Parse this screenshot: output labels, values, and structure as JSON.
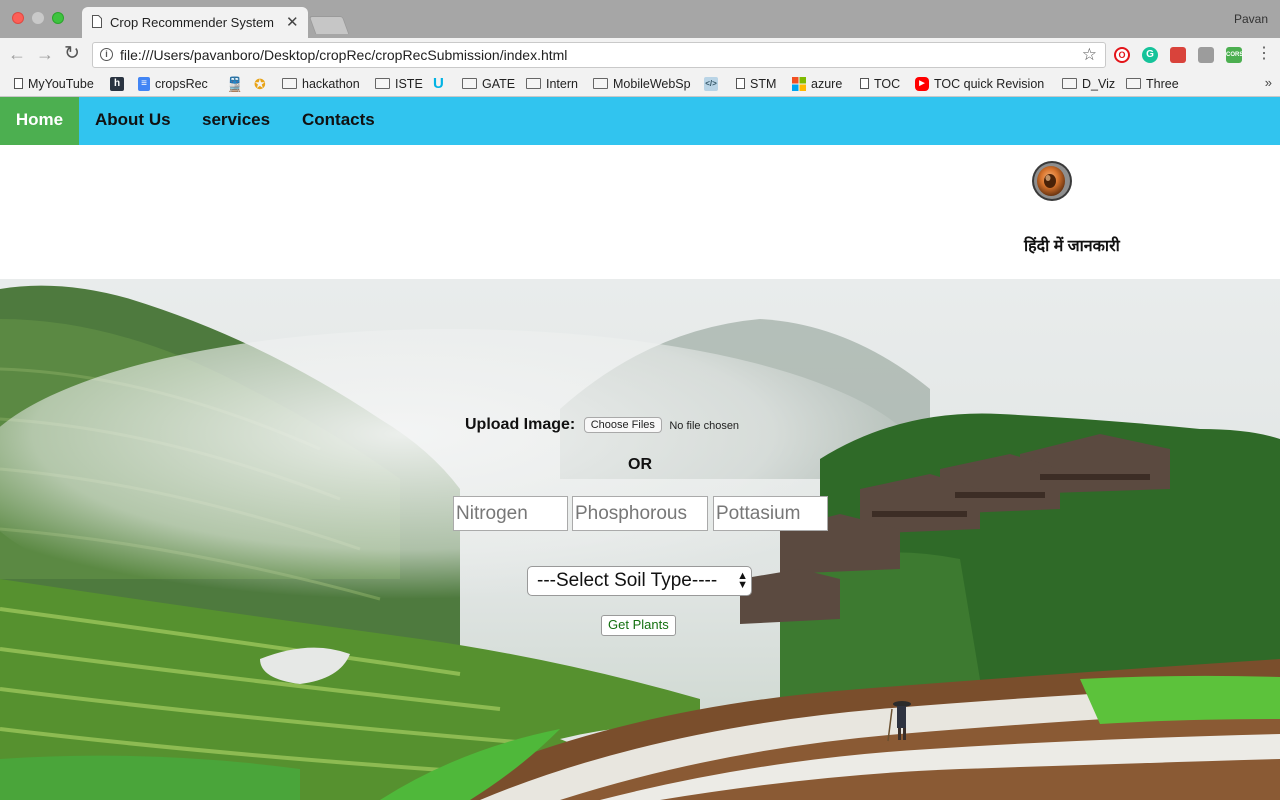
{
  "browser": {
    "tab_title": "Crop Recommender System",
    "tab_close": "✕",
    "profile_name": "Pavan",
    "url": "file:///Users/pavanboro/Desktop/cropRec/cropRecSubmission/index.html",
    "back": "←",
    "forward": "→",
    "reload": "↻",
    "star": "☆",
    "menu": "⋮",
    "ext_opera": "O",
    "ext_grammarly": "G",
    "ext_cors": "CORS",
    "bookmarks_more": "»",
    "bookmarks": [
      {
        "label": "MyYouTube",
        "icon": "page-icon"
      },
      {
        "label": "h",
        "icon": "hashnode-icon"
      },
      {
        "label": "cropsRec",
        "icon": "docs-icon"
      },
      {
        "label": "",
        "icon": "train-icon"
      },
      {
        "label": "",
        "icon": "star-logo-icon"
      },
      {
        "label": "hackathon",
        "icon": "folder-icon"
      },
      {
        "label": "ISTE",
        "icon": "folder-icon"
      },
      {
        "label": "",
        "icon": "udacity-icon"
      },
      {
        "label": "GATE",
        "icon": "folder-icon"
      },
      {
        "label": "Intern",
        "icon": "folder-icon"
      },
      {
        "label": "MobileWebSp",
        "icon": "folder-icon"
      },
      {
        "label": "",
        "icon": "code-icon"
      },
      {
        "label": "STM",
        "icon": "page-icon"
      },
      {
        "label": "azure",
        "icon": "microsoft-icon"
      },
      {
        "label": "TOC",
        "icon": "page-icon"
      },
      {
        "label": "TOC quick Revision",
        "icon": "youtube-icon"
      },
      {
        "label": "D_Viz",
        "icon": "folder-icon"
      },
      {
        "label": "Three",
        "icon": "folder-icon"
      }
    ]
  },
  "nav": {
    "home": "Home",
    "about": "About Us",
    "services": "services",
    "contacts": "Contacts"
  },
  "audio": {
    "hindi_label": "हिंदी में जानकारी",
    "icon": "speaker-icon"
  },
  "form": {
    "upload_label": "Upload Image:",
    "choose_files": "Choose Files",
    "no_file": "No file chosen",
    "or": "OR",
    "nitrogen_placeholder": "Nitrogen",
    "phosphorous_placeholder": "Phosphorous",
    "potassium_placeholder": "Pottasium",
    "soil_select": "---Select Soil Type----",
    "submit": "Get Plants"
  },
  "colors": {
    "navbar": "#31c4ef",
    "home_active": "#4caf50",
    "submit_text": "#14700f"
  }
}
